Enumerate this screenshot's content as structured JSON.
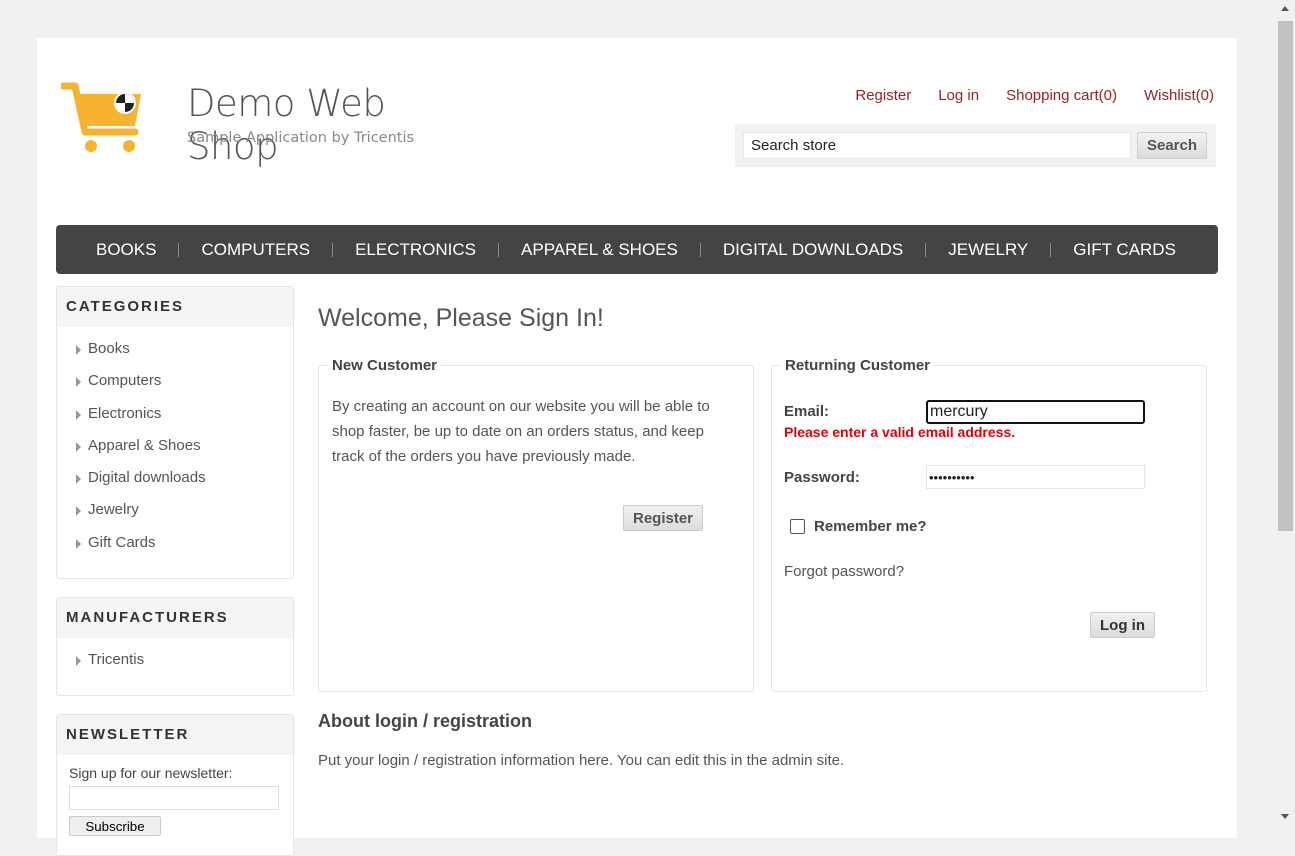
{
  "header": {
    "logo_title": "Demo Web Shop",
    "logo_subtitle": "Sample Application by Tricentis",
    "links": {
      "register": "Register",
      "login": "Log in",
      "cart": "Shopping cart(0)",
      "wishlist": "Wishlist(0)"
    },
    "search": {
      "value": "Search store",
      "button": "Search"
    }
  },
  "nav": [
    "BOOKS",
    "COMPUTERS",
    "ELECTRONICS",
    "APPAREL & SHOES",
    "DIGITAL DOWNLOADS",
    "JEWELRY",
    "GIFT CARDS"
  ],
  "sidebar": {
    "categories": {
      "title": "CATEGORIES",
      "items": [
        "Books",
        "Computers",
        "Electronics",
        "Apparel & Shoes",
        "Digital downloads",
        "Jewelry",
        "Gift Cards"
      ]
    },
    "manufacturers": {
      "title": "MANUFACTURERS",
      "items": [
        "Tricentis"
      ]
    },
    "newsletter": {
      "title": "NEWSLETTER",
      "label": "Sign up for our newsletter:",
      "button": "Subscribe"
    }
  },
  "main": {
    "title": "Welcome, Please Sign In!",
    "new_customer": {
      "legend": "New Customer",
      "text": "By creating an account on our website you will be able to shop faster, be up to date on an orders status, and keep track of the orders you have previously made.",
      "button": "Register"
    },
    "returning_customer": {
      "legend": "Returning Customer",
      "email_label": "Email:",
      "email_value": "mercury",
      "email_error": "Please enter a valid email address.",
      "password_label": "Password:",
      "password_value": "••••••••••",
      "remember_label": "Remember me?",
      "remember_checked": false,
      "forgot": "Forgot password?",
      "login_button": "Log in"
    },
    "topic": {
      "title": "About login / registration",
      "body": "Put your login / registration information here. You can edit this in the admin site."
    }
  },
  "colors": {
    "link_red": "#98202c",
    "error_red": "#e4000b",
    "nav_bg": "#444444",
    "logo_orange": "#f7b230"
  }
}
